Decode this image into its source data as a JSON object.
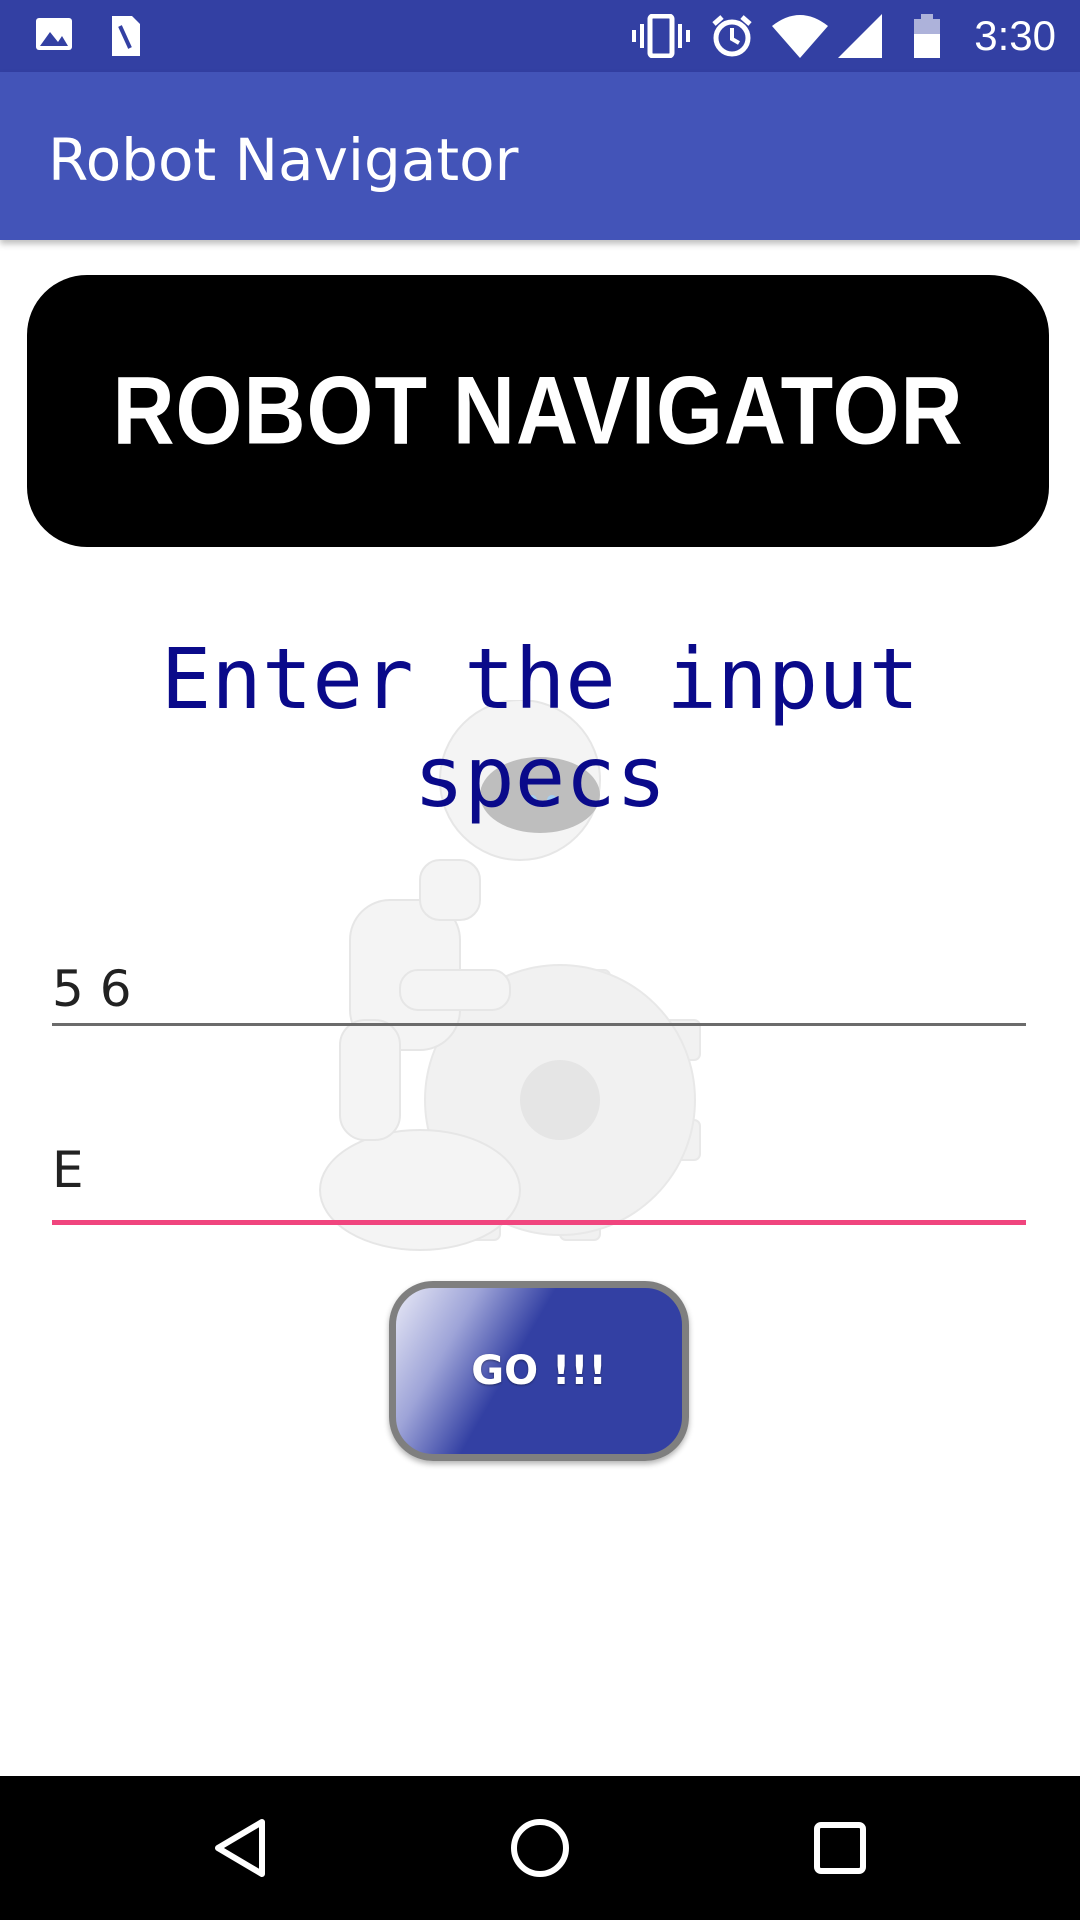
{
  "status_bar": {
    "time": "3:30",
    "icons": [
      "image-icon",
      "sim-icon",
      "vibrate-icon",
      "alarm-icon",
      "wifi-icon",
      "signal-icon",
      "battery-icon"
    ]
  },
  "app_bar": {
    "title": "Robot Navigator",
    "color": "#4354b8"
  },
  "banner": {
    "text": "ROBOT NAVIGATOR"
  },
  "form": {
    "heading": "Enter the input specs",
    "field1": {
      "value": "5 6"
    },
    "field2": {
      "value": "E"
    },
    "go_button": "GO !!!"
  },
  "nav_bar": {
    "buttons": [
      "back-icon",
      "home-icon",
      "recents-icon"
    ]
  },
  "colors": {
    "status_bar": "#3340a3",
    "accent": "#f0457e",
    "heading": "#0a0a8a"
  }
}
